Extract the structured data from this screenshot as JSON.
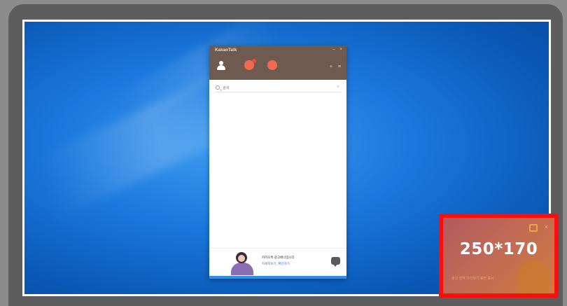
{
  "messenger": {
    "title": "KakaoTalk",
    "window_controls": {
      "minimize": "–",
      "close": "×"
    },
    "header_small_icons": [
      "+",
      "≡"
    ],
    "search": {
      "placeholder": "검색"
    },
    "search_add": "+",
    "ad": {
      "time": "",
      "line1": "카카오톡 광고배너입니다",
      "line2": "자세히보기, 확인하기"
    }
  },
  "highlight": {
    "size_label": "250*170",
    "close": "×",
    "caption": "광고 영역 미리보기 화면 표시"
  },
  "colors": {
    "header": "#6f5a50",
    "highlight_border": "#ff0d0d",
    "desktop": "#1b78dc",
    "accent_orange": "#f06b4e"
  },
  "icons": {
    "header": [
      "person-icon",
      "chat-icon",
      "more-icon"
    ],
    "ad": [
      "chat-bubble-icon"
    ],
    "highlight": [
      "chat-icon",
      "close-icon"
    ]
  }
}
